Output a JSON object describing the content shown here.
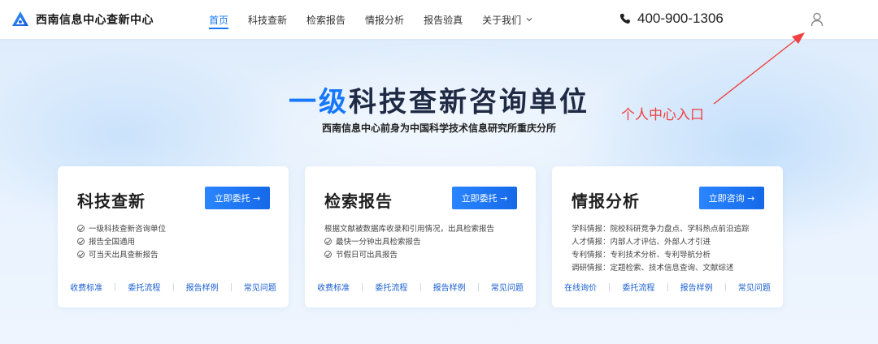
{
  "header": {
    "logo_text": "西南信息中心查新中心",
    "nav": [
      {
        "label": "首页",
        "active": true
      },
      {
        "label": "科技查新",
        "active": false
      },
      {
        "label": "检索报告",
        "active": false
      },
      {
        "label": "情报分析",
        "active": false
      },
      {
        "label": "报告验真",
        "active": false
      },
      {
        "label": "关于我们",
        "active": false,
        "dropdown": true
      }
    ],
    "phone": "400-900-1306",
    "phone_icon": "phone-icon",
    "user_icon": "user-icon"
  },
  "hero": {
    "title_part1": "一级",
    "title_part2": "科技查新咨询单位",
    "subtitle": "西南信息中心前身为中国科学技术信息研究所重庆分所"
  },
  "annotation": {
    "text": "个人中心入口",
    "color": "#f04040"
  },
  "cards": [
    {
      "title": "科技查新",
      "button": "立即委托 →",
      "lines": [
        {
          "text": "一级科技查新咨询单位",
          "check": true
        },
        {
          "text": "报告全国通用",
          "check": true
        },
        {
          "text": "可当天出具查新报告",
          "check": true
        }
      ],
      "links": [
        "收费标准",
        "委托流程",
        "报告样例",
        "常见问题"
      ]
    },
    {
      "title": "检索报告",
      "button": "立即委托 →",
      "lines": [
        {
          "text": "根据文献被数据库收录和引用情况，出具检索报告",
          "check": false
        },
        {
          "text": "最快一分钟出具检索报告",
          "check": true
        },
        {
          "text": "节假日可出具报告",
          "check": true
        }
      ],
      "links": [
        "收费标准",
        "委托流程",
        "报告样例",
        "常见问题"
      ]
    },
    {
      "title": "情报分析",
      "button": "立即咨询 →",
      "lines": [
        {
          "text": "学科情报：院校科研竞争力盘点、学科热点前沿追踪",
          "check": false
        },
        {
          "text": "人才情报：内部人才评估、外部人才引进",
          "check": false
        },
        {
          "text": "专利情报：专利技术分析、专利导航分析",
          "check": false
        },
        {
          "text": "调研情报：定题检索、技术信息查询、文献综述",
          "check": false
        }
      ],
      "links": [
        "在线询价",
        "委托流程",
        "报告样例",
        "常见问题"
      ]
    }
  ],
  "colors": {
    "accent": "#1677ff",
    "link": "#1a5fd0"
  }
}
